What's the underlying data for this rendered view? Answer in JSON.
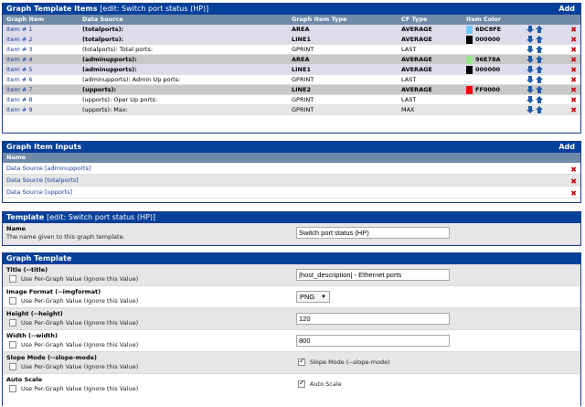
{
  "items_panel": {
    "title": "Graph Template Items",
    "subtitle": "[edit: Switch port status (HP)]",
    "add_label": "Add",
    "columns": [
      "Graph Item",
      "Data Source",
      "Graph Item Type",
      "CF Type",
      "Item Color"
    ],
    "rows": [
      {
        "item": "Item # 1",
        "source": "(totalports):",
        "type": "AREA",
        "cf": "AVERAGE",
        "color_hex": "6DC8FE",
        "swatch": "#6dc8fe",
        "style": "band",
        "bold": true
      },
      {
        "item": "Item # 2",
        "source": "(totalports):",
        "type": "LINE1",
        "cf": "AVERAGE",
        "color_hex": "000000",
        "swatch": "#000000",
        "style": "band",
        "bold": true
      },
      {
        "item": "Item # 3",
        "source": "(totalports): Total ports:",
        "type": "GPRINT",
        "cf": "LAST",
        "color_hex": "",
        "swatch": "",
        "style": "",
        "bold": false
      },
      {
        "item": "Item # 4",
        "source": "(adminupports):",
        "type": "AREA",
        "cf": "AVERAGE",
        "color_hex": "96E78A",
        "swatch": "#96e78a",
        "style": "dark",
        "bold": true
      },
      {
        "item": "Item # 5",
        "source": "(adminupports):",
        "type": "LINE1",
        "cf": "AVERAGE",
        "color_hex": "000000",
        "swatch": "#000000",
        "style": "band",
        "bold": true
      },
      {
        "item": "Item # 6",
        "source": "(adminupports): Admin Up ports:",
        "type": "GPRINT",
        "cf": "LAST",
        "color_hex": "",
        "swatch": "",
        "style": "",
        "bold": false
      },
      {
        "item": "Item # 7",
        "source": "(upports):",
        "type": "LINE2",
        "cf": "AVERAGE",
        "color_hex": "FF0000",
        "swatch": "#ff0000",
        "style": "dark",
        "bold": true
      },
      {
        "item": "Item # 8",
        "source": "(upports): Oper Up ports:",
        "type": "GPRINT",
        "cf": "LAST",
        "color_hex": "",
        "swatch": "",
        "style": "",
        "bold": false
      },
      {
        "item": "Item # 9",
        "source": "(upports): Max:",
        "type": "GPRINT",
        "cf": "MAX",
        "color_hex": "",
        "swatch": "",
        "style": "alt",
        "bold": false
      }
    ]
  },
  "inputs_panel": {
    "title": "Graph Item Inputs",
    "add_label": "Add",
    "column": "Name",
    "rows": [
      "Data Source [adminupports]",
      "Data Source [totalports]",
      "Data Source [upports]"
    ]
  },
  "template_panel": {
    "title": "Template",
    "subtitle": "[edit: Switch port status (HP)]",
    "name_label": "Name",
    "name_desc": "The name given to this graph template.",
    "name_value": "Switch port status (HP)"
  },
  "graph_panel": {
    "title": "Graph Template",
    "per_graph_label": "Use Per-Graph Value (Ignore this Value)",
    "fields": {
      "title": {
        "label": "Title (--title)",
        "value": "|host_description| - Ethernet ports"
      },
      "imgformat": {
        "label": "Image Format (--imgformat)",
        "value": "PNG"
      },
      "height": {
        "label": "Height (--height)",
        "value": "120"
      },
      "width": {
        "label": "Width (--width)",
        "value": "800"
      },
      "slope": {
        "label": "Slope Mode (--slope-mode)",
        "check_label": "Slope Mode (--slope-mode)"
      },
      "autoscale": {
        "label": "Auto Scale",
        "check_label": "Auto Scale"
      }
    }
  },
  "colors": {
    "header": "#05409a",
    "colhdr": "#708aa8",
    "link": "#1a3e9a",
    "delete": "#d40000",
    "arrow": "#1e5aa8"
  }
}
